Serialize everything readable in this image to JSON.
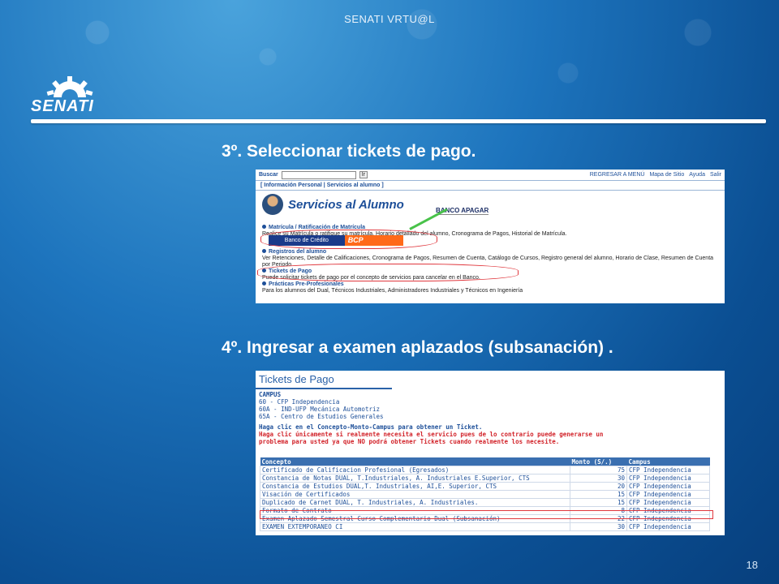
{
  "slide": {
    "header_title": "SENATI VRTU@L",
    "logo_text": "SENATI",
    "page_number": "18",
    "step3": "3º. Seleccionar tickets de pago.",
    "step4": "4º. Ingresar a examen aplazados (subsanación) ."
  },
  "shot1": {
    "search_label": "Buscar",
    "search_button": "Ir",
    "top_links": [
      "REGRESAR A MENÚ",
      "Mapa de Sitio",
      "Ayuda",
      "Salir"
    ],
    "tabs_text": "[ Información Personal | Servicios al alumno ]",
    "heading": "Servicios al Alumno",
    "callout": "BANCO APAGAR",
    "items": [
      {
        "title": "Matrícula / Ratificación de Matrícula",
        "desc": "Realice su Matrícula o ratifique su matrícula, Horario detallado del alumno, Cronograma de Pagos, Historial de Matrícula."
      },
      {
        "title": "Registros del alumno",
        "desc": "Ver Retenciones, Detalle de Calificaciones, Cronograma de Pagos, Resumen de Cuenta, Catálogo de Cursos, Registro general del alumno, Horario de Clase, Resumen de Cuenta por Periodo"
      },
      {
        "title": "Tickets de Pago",
        "desc": "Puede solicitar tickets de pago por el concepto de servicios para cancelar en el Banco."
      },
      {
        "title": "Prácticas Pre-Profesionales",
        "desc": "Para los alumnos del Dual, Técnicos Industriales, Administradores Industriales y Técnicos en Ingeniería"
      }
    ],
    "bank_label": "Banco de Crédito",
    "bank_logo": "BCP"
  },
  "shot2": {
    "title": "Tickets de Pago",
    "campus_header": "CAMPUS",
    "campus_list": [
      "60 - CFP Independencia",
      "60A - IND-UFP Mecánica Automotriz",
      "65A - Centro de Estudios Generales"
    ],
    "instruction": "Haga clic en el Concepto-Monto-Campus para obtener un Ticket.",
    "warning": "Haga clic únicamente si realmente necesita el servicio pues de lo contrario puede generarse un problema para usted ya que NO podrá obtener Tickets cuando realmente los necesite.",
    "columns": [
      "Concepto",
      "Monto (S/.)",
      "Campus"
    ],
    "rows": [
      [
        "Certificado de Calificacion Profesional (Egresados)",
        "75",
        "CFP Independencia"
      ],
      [
        "Constancia de Notas DUAL, T.Industriales, A. Industriales E.Superior, CTS",
        "30",
        "CFP Independencia"
      ],
      [
        "Constancia de Estudios DUAL,T. Industriales, AI,E. Superior, CTS",
        "20",
        "CFP Independencia"
      ],
      [
        "Visación de Certificados",
        "15",
        "CFP Independencia"
      ],
      [
        "Duplicado de Carnet DUAL, T. Industriales, A. Industriales.",
        "15",
        "CFP Independencia"
      ],
      [
        "Formato de Contrato",
        "8",
        "CFP Independencia"
      ],
      [
        "Examen Aplazado Semestral Curso Complementario Dual (Subsanación)",
        "22",
        "CFP Independencia"
      ],
      [
        "EXAMEN EXTEMPORANEO CI",
        "30",
        "CFP Independencia"
      ]
    ]
  }
}
